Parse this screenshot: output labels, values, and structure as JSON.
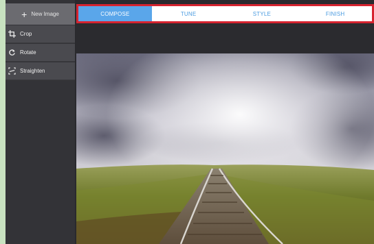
{
  "sidebar": {
    "new_image_label": "New Image",
    "items": [
      {
        "label": "Crop",
        "icon": "crop-icon"
      },
      {
        "label": "Rotate",
        "icon": "rotate-icon"
      },
      {
        "label": "Straighten",
        "icon": "straighten-icon"
      }
    ]
  },
  "tabs": [
    {
      "label": "COMPOSE",
      "active": true
    },
    {
      "label": "TUNE",
      "active": false
    },
    {
      "label": "STYLE",
      "active": false
    },
    {
      "label": "FINISH",
      "active": false
    }
  ],
  "colors": {
    "accent": "#5aa6ea",
    "highlight_border": "#d6232f",
    "sidebar_bg": "#333337",
    "canvas_bg": "#2a2a2e"
  },
  "photo": {
    "icon": "landscape-photo-railway-tracks"
  }
}
